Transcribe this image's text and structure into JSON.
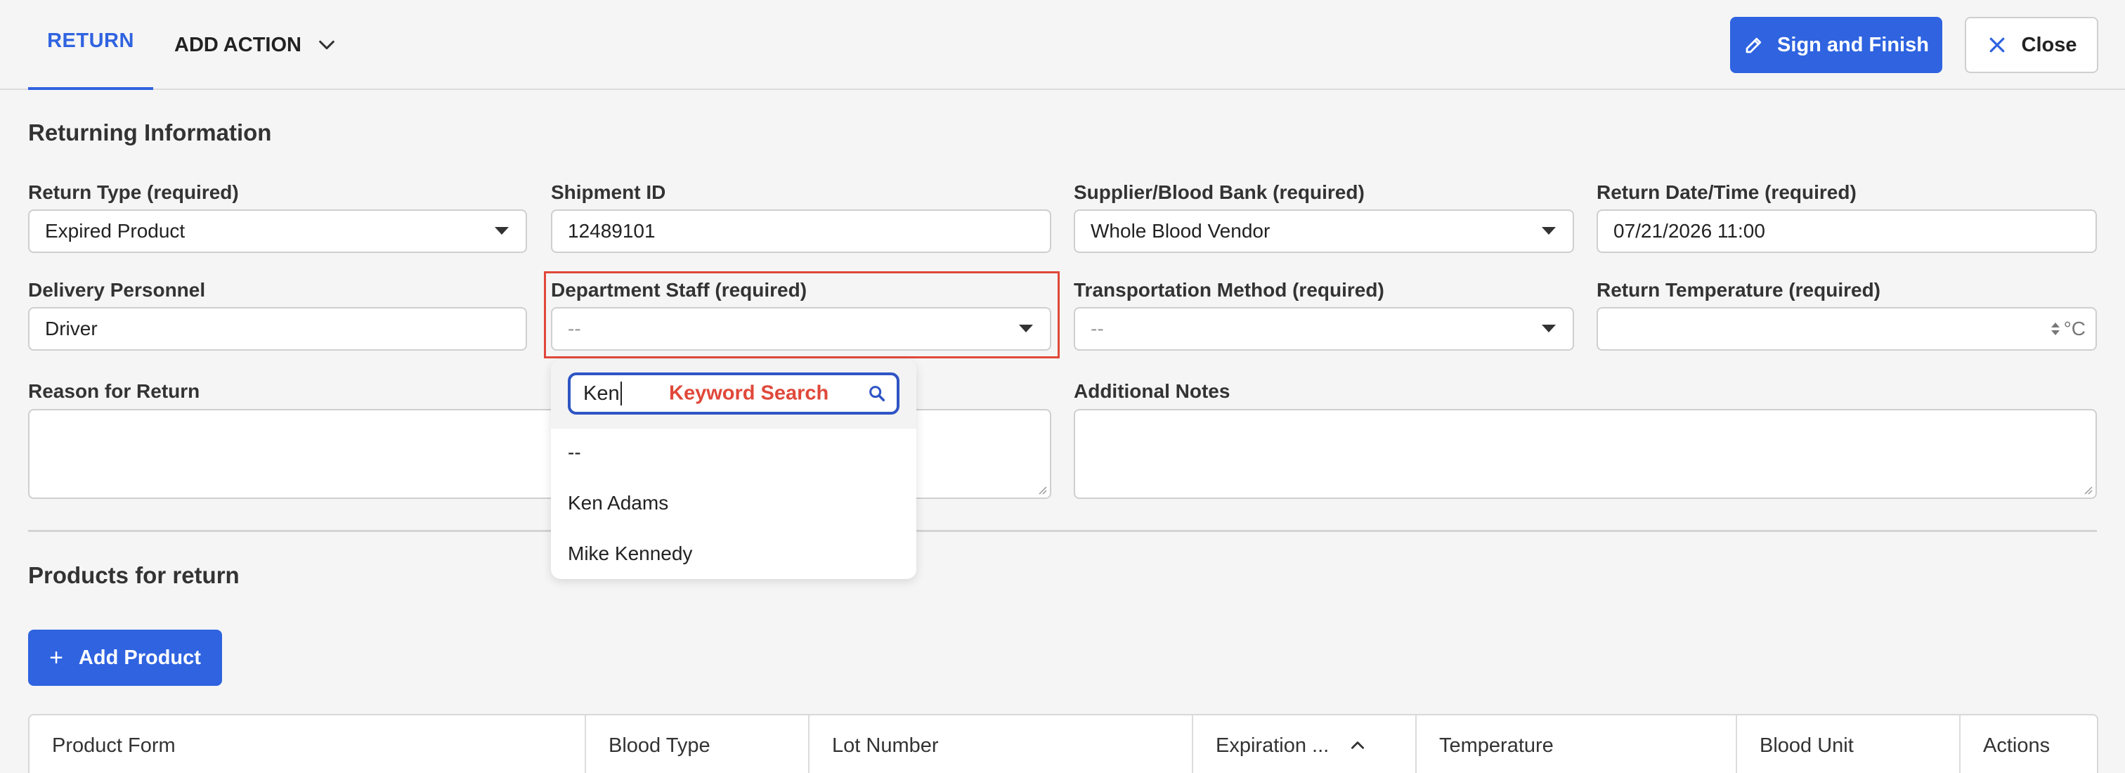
{
  "tabs": {
    "return_label": "RETURN",
    "add_action_label": "ADD ACTION"
  },
  "actions": {
    "sign_finish_label": "Sign and Finish",
    "close_label": "Close"
  },
  "returning_section": {
    "title": "Returning Information",
    "return_type": {
      "label": "Return Type (required)",
      "value": "Expired Product"
    },
    "shipment_id": {
      "label": "Shipment ID",
      "value": "12489101"
    },
    "supplier": {
      "label": "Supplier/Blood Bank (required)",
      "value": "Whole Blood Vendor"
    },
    "return_datetime": {
      "label": "Return Date/Time (required)",
      "value": "07/21/2026 11:00"
    },
    "delivery_personnel": {
      "label": "Delivery Personnel",
      "value": "Driver"
    },
    "department_staff": {
      "label": "Department Staff (required)",
      "value": "--"
    },
    "transportation_method": {
      "label": "Transportation Method (required)",
      "value": "--"
    },
    "return_temperature": {
      "label": "Return Temperature (required)",
      "value": "",
      "unit": "°C"
    },
    "reason_for_return": {
      "label": "Reason for Return",
      "value": ""
    },
    "additional_notes": {
      "label": "Additional Notes",
      "value": ""
    }
  },
  "staff_dropdown": {
    "search_value": "Ken",
    "search_hint": "Keyword Search",
    "options": [
      "--",
      "Ken Adams",
      "Mike Kennedy"
    ]
  },
  "products_section": {
    "title": "Products for return",
    "add_product_label": "Add Product",
    "columns": [
      "Product Form",
      "Blood Type",
      "Lot Number",
      "Expiration ...",
      "Temperature",
      "Blood Unit",
      "Actions"
    ]
  },
  "colors": {
    "accent": "#2f63e0",
    "highlight": "#e0483a"
  }
}
